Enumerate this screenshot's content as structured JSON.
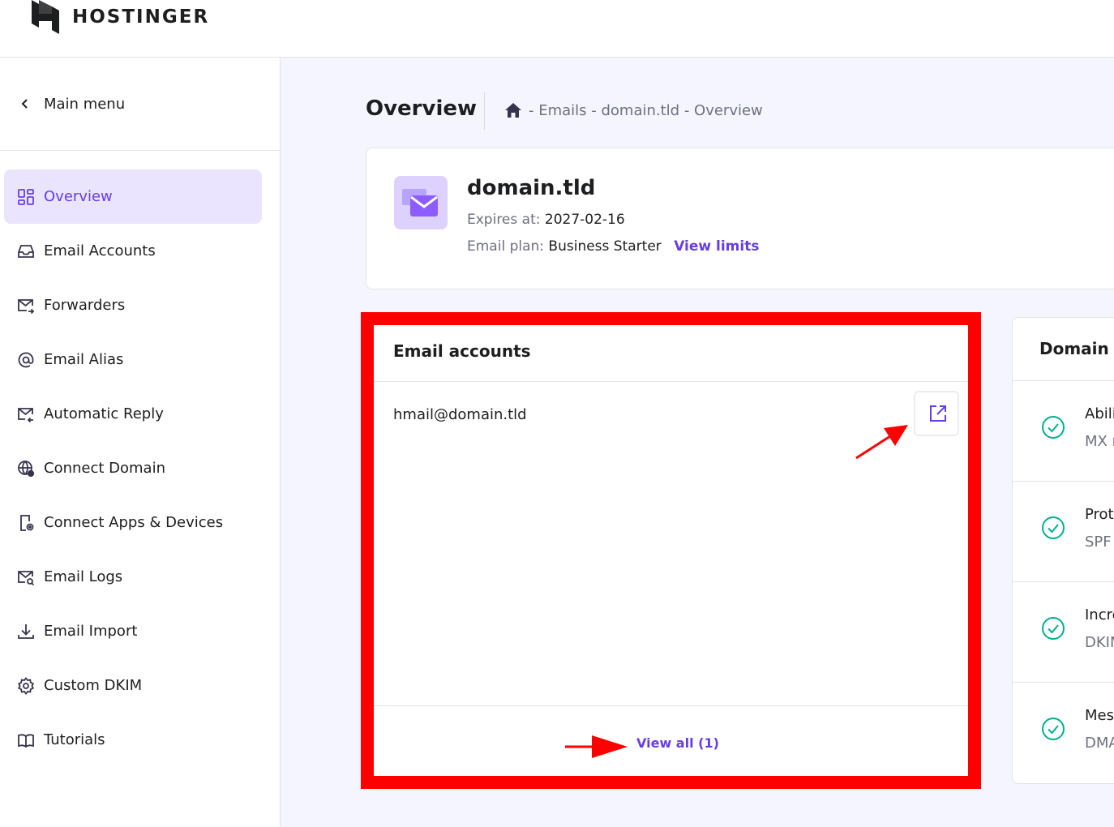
{
  "header": {
    "brand": "HOSTINGER"
  },
  "sidebar": {
    "back_label": "Main menu",
    "items": [
      {
        "label": "Overview",
        "icon": "grid-icon",
        "active": true
      },
      {
        "label": "Email Accounts",
        "icon": "inbox-icon"
      },
      {
        "label": "Forwarders",
        "icon": "forward-mail-icon"
      },
      {
        "label": "Email Alias",
        "icon": "at-icon"
      },
      {
        "label": "Automatic Reply",
        "icon": "reply-mail-icon"
      },
      {
        "label": "Connect Domain",
        "icon": "globe-settings-icon"
      },
      {
        "label": "Connect Apps & Devices",
        "icon": "device-settings-icon"
      },
      {
        "label": "Email Logs",
        "icon": "mail-search-icon"
      },
      {
        "label": "Email Import",
        "icon": "download-icon"
      },
      {
        "label": "Custom DKIM",
        "icon": "gear-icon"
      },
      {
        "label": "Tutorials",
        "icon": "book-icon"
      }
    ]
  },
  "main": {
    "title": "Overview",
    "breadcrumb": "- Emails - domain.tld - Overview",
    "domain_card": {
      "name": "domain.tld",
      "expires_label": "Expires at:",
      "expires_value": "2027-02-16",
      "plan_label": "Email plan:",
      "plan_value": "Business Starter",
      "view_limits": "View limits"
    },
    "email_accounts": {
      "title": "Email accounts",
      "accounts": [
        "hmail@domain.tld"
      ],
      "view_all": "View all (1)"
    },
    "domain_status": {
      "title": "Domain s",
      "rows": [
        {
          "a": "Abili",
          "b": "MX r"
        },
        {
          "a": "Prot",
          "b": "SPF"
        },
        {
          "a": "Incre",
          "b": "DKIM"
        },
        {
          "a": "Mes",
          "b": "DMA"
        }
      ]
    }
  },
  "colors": {
    "accent": "#673de6",
    "accent_bg": "#ebe4ff",
    "annotation": "#ff0000",
    "success": "#00b090"
  }
}
